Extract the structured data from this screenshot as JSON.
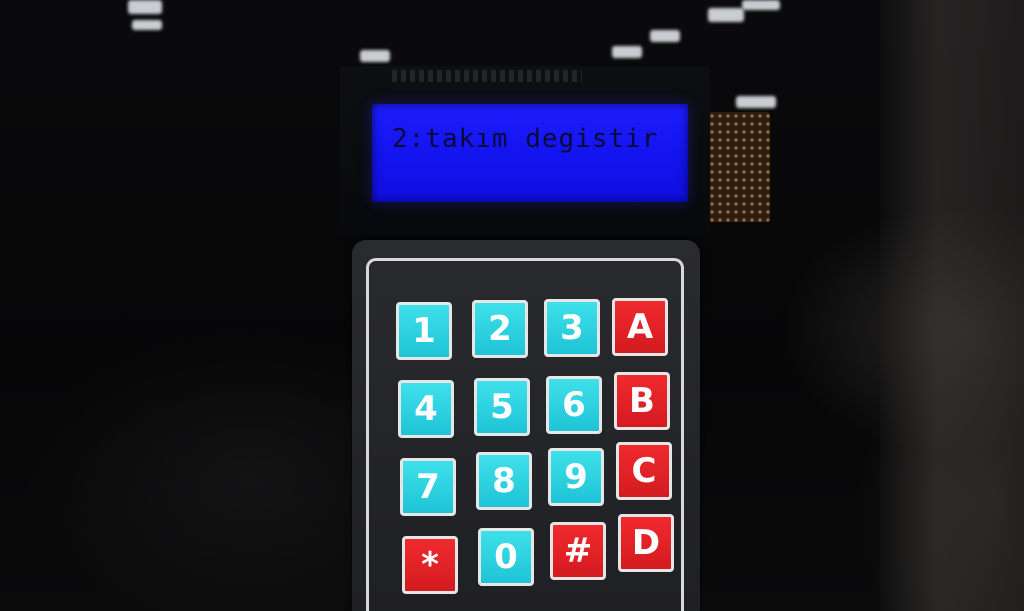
{
  "lcd": {
    "text": "2:takım degistir"
  },
  "keypad": {
    "keys": [
      {
        "label": "1",
        "color": "#29d3e0"
      },
      {
        "label": "2",
        "color": "#29d3e0"
      },
      {
        "label": "3",
        "color": "#29d3e0"
      },
      {
        "label": "A",
        "color": "#e4252a"
      },
      {
        "label": "4",
        "color": "#29d3e0"
      },
      {
        "label": "5",
        "color": "#29d3e0"
      },
      {
        "label": "6",
        "color": "#29d3e0"
      },
      {
        "label": "B",
        "color": "#e4252a"
      },
      {
        "label": "7",
        "color": "#29d3e0"
      },
      {
        "label": "8",
        "color": "#29d3e0"
      },
      {
        "label": "9",
        "color": "#29d3e0"
      },
      {
        "label": "C",
        "color": "#e4252a"
      },
      {
        "label": "*",
        "color": "#e4252a"
      },
      {
        "label": "0",
        "color": "#29d3e0"
      },
      {
        "label": "#",
        "color": "#e4252a"
      },
      {
        "label": "D",
        "color": "#e4252a"
      }
    ]
  },
  "colors": {
    "lcd_backlight": "#1a1aff",
    "keypad_body": "#232427",
    "key_blue": "#29d3e0",
    "key_red": "#e4252a"
  }
}
